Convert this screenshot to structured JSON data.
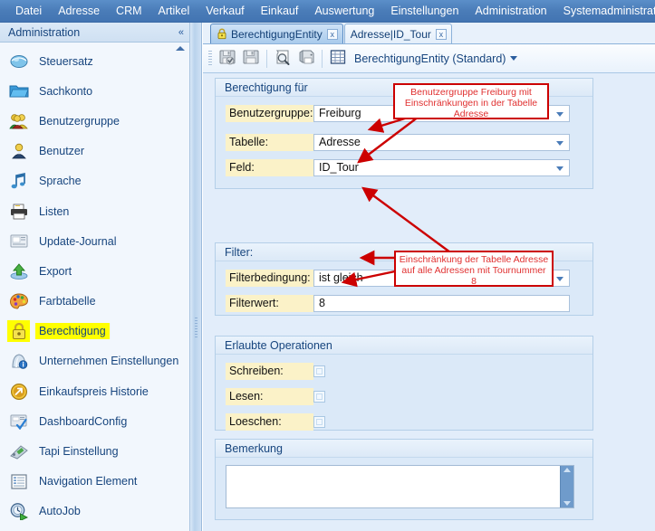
{
  "menubar": {
    "items": [
      {
        "label": "Datei"
      },
      {
        "label": "Adresse"
      },
      {
        "label": "CRM"
      },
      {
        "label": "Artikel"
      },
      {
        "label": "Verkauf"
      },
      {
        "label": "Einkauf"
      },
      {
        "label": "Auswertung"
      },
      {
        "label": "Einstellungen"
      },
      {
        "label": "Administration"
      },
      {
        "label": "Systemadministration"
      }
    ]
  },
  "sidebar": {
    "title": "Administration",
    "collapse_icon": "chevron-double-left-icon",
    "scroll_up_icon": "scroll-up-arrow-icon",
    "items": [
      {
        "label": "Steuersatz",
        "icon": "tax-globe-icon",
        "selected": false
      },
      {
        "label": "Sachkonto",
        "icon": "folder-icon",
        "selected": false
      },
      {
        "label": "Benutzergruppe",
        "icon": "user-group-icon",
        "selected": false
      },
      {
        "label": "Benutzer",
        "icon": "user-icon",
        "selected": false
      },
      {
        "label": "Sprache",
        "icon": "music-note-icon",
        "selected": false
      },
      {
        "label": "Listen",
        "icon": "printer-list-icon",
        "selected": false
      },
      {
        "label": "Update-Journal",
        "icon": "journal-icon",
        "selected": false
      },
      {
        "label": "Export",
        "icon": "export-up-arrow-icon",
        "selected": false
      },
      {
        "label": "Farbtabelle",
        "icon": "color-palette-icon",
        "selected": false
      },
      {
        "label": "Berechtigung",
        "icon": "padlock-icon",
        "selected": true
      },
      {
        "label": "Unternehmen Einstellungen",
        "icon": "company-info-icon",
        "selected": false
      },
      {
        "label": "Einkaufspreis Historie",
        "icon": "orange-arrow-icon",
        "selected": false
      },
      {
        "label": "DashboardConfig",
        "icon": "dashboard-check-icon",
        "selected": false
      },
      {
        "label": "Tapi Einstellung",
        "icon": "telephone-icon",
        "selected": false
      },
      {
        "label": "Navigation Element",
        "icon": "navigation-list-icon",
        "selected": false
      },
      {
        "label": "AutoJob",
        "icon": "autojob-clock-icon",
        "selected": false
      }
    ]
  },
  "tabs": [
    {
      "label": "BerechtigungEntity",
      "icon": "padlock-icon",
      "active": true,
      "close_label": "x"
    },
    {
      "label": "Adresse|ID_Tour",
      "icon": "",
      "active": false,
      "close_label": "x"
    }
  ],
  "toolbar": {
    "buttons": [
      {
        "name": "save-and-check-button",
        "icon": "floppy-check-icon"
      },
      {
        "name": "save-button",
        "icon": "floppy-icon"
      },
      {
        "name": "print-preview-button",
        "icon": "page-magnifier-icon"
      },
      {
        "name": "print-button",
        "icon": "printer-icon"
      },
      {
        "name": "grid-layout-button",
        "icon": "grid-icon"
      }
    ],
    "view_label": "BerechtigungEntity (Standard)",
    "view_caret_icon": "chevron-down-icon"
  },
  "form": {
    "group_berechtigung": {
      "title": "Berechtigung für",
      "fields": [
        {
          "label": "Benutzergruppe:",
          "value": "Freiburg",
          "type": "combo"
        },
        {
          "label": "Tabelle:",
          "value": "Adresse",
          "type": "combo"
        },
        {
          "label": "Feld:",
          "value": "ID_Tour",
          "type": "combo"
        }
      ]
    },
    "group_filter": {
      "title": "Filter:",
      "fields": [
        {
          "label": "Filterbedingung:",
          "value": "ist gleich",
          "type": "combo"
        },
        {
          "label": "Filterwert:",
          "value": "8",
          "type": "text"
        }
      ]
    },
    "group_operationen": {
      "title": "Erlaubte Operationen",
      "fields": [
        {
          "label": "Schreiben:",
          "checked": false
        },
        {
          "label": "Lesen:",
          "checked": false
        },
        {
          "label": "Loeschen:",
          "checked": false
        }
      ]
    },
    "group_bemerkung": {
      "title": "Bemerkung",
      "value": "",
      "placeholder": ""
    }
  },
  "annotations": [
    {
      "id": "callout-1",
      "text": "Benutzergruppe Freiburg mit Einschränkungen in der Tabelle Adresse"
    },
    {
      "id": "callout-2",
      "text": "Einschränkung der Tabelle Adresse auf alle Adressen mit Tournummer 8"
    }
  ],
  "colors": {
    "menubar": "#4a7cb8",
    "accent_text": "#17457e",
    "highlight": "#ffff00",
    "label_bg": "#fbf2c8",
    "annotation": "#cc0000",
    "panel_bg": "#dbe9f8",
    "work_bg": "#e2edfa"
  }
}
